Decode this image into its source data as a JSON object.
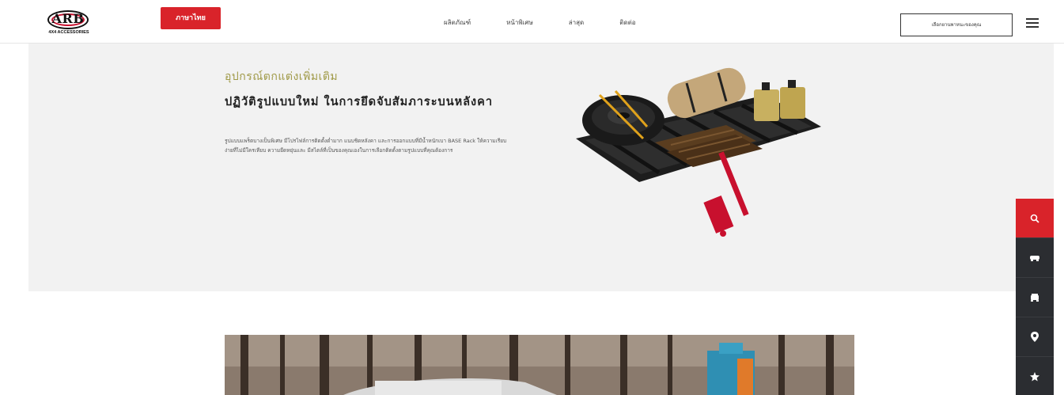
{
  "header": {
    "logo": {
      "word": "ARB",
      "sub": "4X4 ACCESSORIES"
    },
    "language_button": "ภาษาไทย",
    "nav": [
      "ผลิตภัณฑ์",
      "หน้าพิเศษ",
      "ล่าสุด",
      "ติดต่อ"
    ],
    "dealer_button": "เลือกยานพาหนะของคุณ",
    "menu_icon": "hamburger-icon"
  },
  "hero": {
    "eyebrow": "อุปกรณ์ตกแต่งเพิ่มเติม",
    "headline": "ปฏิวัติรูปแบบใหม่ ในการยึดจับสัมภาระบนหลังคา",
    "body": "รูปแบบแพร็ตบางเป็นพิเศษ มีโปรไฟล์การติดตั้งต่ำมาก แนบชิดหลังคา และการออกแบบที่มีน้ำหนักเบา BASE Rack ให้ความเรียบง่ายที่ไม่มีใครเทียบ ความยืดหยุ่นและ มีสไตล์ที่เป็นของคุณเองในการเลือกติดตั้งตามรูปแบบที่คุณต้องการ"
  },
  "dock": [
    "search-icon",
    "vehicle-icon",
    "car-front-icon",
    "location-pin-icon",
    "star-icon"
  ],
  "colors": {
    "accent_red": "#d9232a",
    "olive": "#a09a48",
    "dock_dark": "#2b2d31",
    "hero_bg": "#f2f2f2"
  }
}
